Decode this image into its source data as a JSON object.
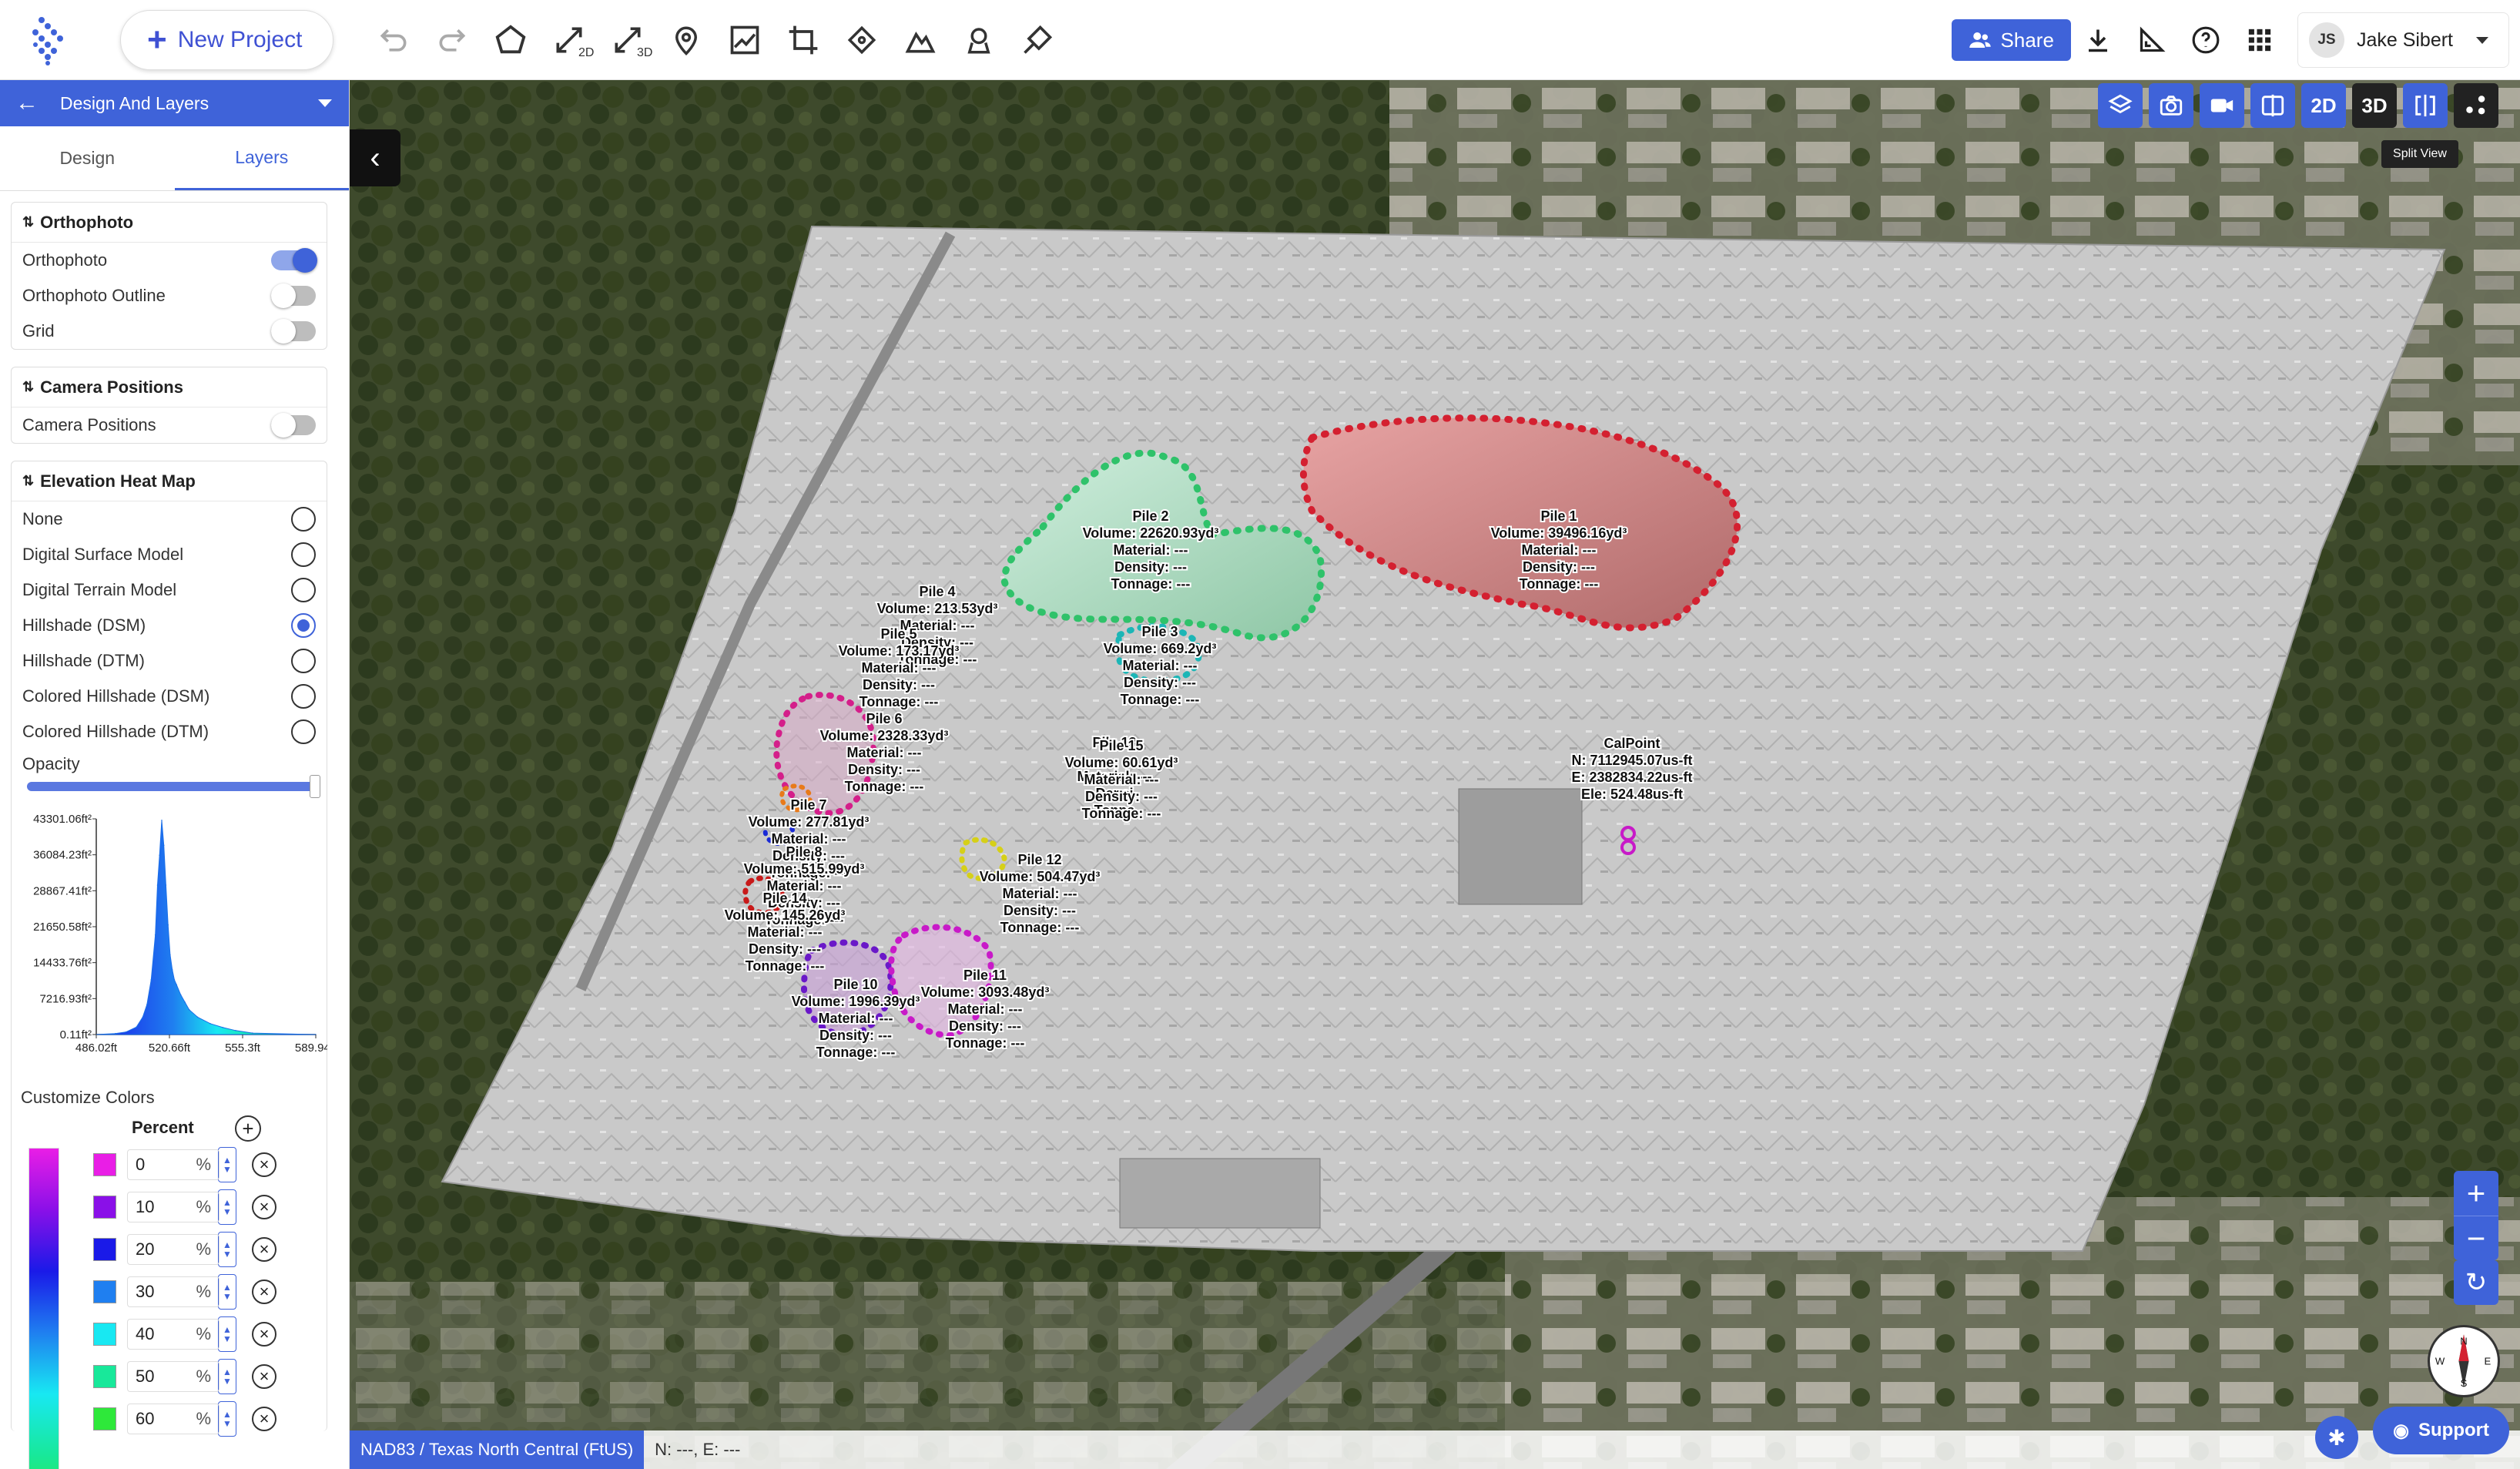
{
  "toolbar": {
    "new_project_label": "New Project",
    "tool_2d_sub": "2D",
    "tool_3d_sub": "3D",
    "share_label": "Share",
    "user_initials": "JS",
    "user_name": "Jake Sibert"
  },
  "sidebar": {
    "header_title": "Design And Layers",
    "tabs": [
      "Design",
      "Layers"
    ],
    "active_tab": "Layers",
    "orthophoto": {
      "title": "Orthophoto",
      "items": [
        {
          "label": "Orthophoto",
          "on": true
        },
        {
          "label": "Orthophoto Outline",
          "on": false
        },
        {
          "label": "Grid",
          "on": false
        }
      ]
    },
    "camera": {
      "title": "Camera Positions",
      "items": [
        {
          "label": "Camera Positions",
          "on": false
        }
      ]
    },
    "heatmap": {
      "title": "Elevation Heat Map",
      "options": [
        "None",
        "Digital Surface Model",
        "Digital Terrain Model",
        "Hillshade (DSM)",
        "Hillshade (DTM)",
        "Colored Hillshade (DSM)",
        "Colored Hillshade (DTM)"
      ],
      "selected": "Hillshade (DSM)",
      "opacity_label": "Opacity",
      "opacity_value": 1.0
    },
    "customize_colors_label": "Customize Colors",
    "percent_header": "Percent",
    "percent_suffix": "%",
    "color_stops": [
      {
        "percent": "0",
        "color": "#e91ee6"
      },
      {
        "percent": "10",
        "color": "#8a10e8"
      },
      {
        "percent": "20",
        "color": "#1a1ae8"
      },
      {
        "percent": "30",
        "color": "#1f7ff0"
      },
      {
        "percent": "40",
        "color": "#18e8f2"
      },
      {
        "percent": "50",
        "color": "#18e89a"
      },
      {
        "percent": "60",
        "color": "#2ee83a"
      }
    ]
  },
  "chart_data": {
    "type": "area",
    "title": "",
    "xlabel": "",
    "ylabel": "",
    "y_ticks": [
      "43301.06ft²",
      "36084.23ft²",
      "28867.41ft²",
      "21650.58ft²",
      "14433.76ft²",
      "7216.93ft²",
      "0.11ft²"
    ],
    "x_ticks": [
      "486.02ft",
      "520.66ft",
      "555.3ft",
      "589.94ft"
    ],
    "xlim": [
      486.02,
      589.94
    ],
    "ylim": [
      0.11,
      43301.06
    ],
    "x": [
      486.02,
      495,
      500,
      505,
      508,
      510,
      512,
      514,
      515,
      516,
      517,
      518,
      519,
      520,
      521,
      522,
      523,
      524,
      526,
      528,
      530,
      534,
      540,
      546,
      552,
      560,
      589.94
    ],
    "values": [
      0.11,
      200,
      500,
      1500,
      3500,
      6000,
      11000,
      20000,
      30000,
      36000,
      43000,
      38000,
      30000,
      22000,
      16000,
      13000,
      11000,
      10000,
      8000,
      6500,
      5000,
      3500,
      2200,
      1400,
      800,
      300,
      0.11
    ]
  },
  "map": {
    "view_2d": "2D",
    "view_3d": "3D",
    "split_view_tooltip": "Split View",
    "crs_label": "NAD83 / Texas North Central (FtUS)",
    "coords_label": "N: ---, E: ---",
    "support_label": "Support",
    "zoom_in": "+",
    "zoom_out": "−",
    "compass": {
      "n": "N",
      "s": "S",
      "e": "E",
      "w": "W"
    },
    "piles": [
      {
        "name": "Pile 1",
        "volume": "Volume: 39496.16yd³",
        "material": "Material: ---",
        "density": "Density: ---",
        "tonnage": "Tonnage: ---",
        "color": "#d42030"
      },
      {
        "name": "Pile 2",
        "volume": "Volume: 22620.93yd³",
        "material": "Material: ---",
        "density": "Density: ---",
        "tonnage": "Tonnage: ---",
        "color": "#2fc26a"
      },
      {
        "name": "Pile 3",
        "volume": "Volume: 669.2yd³",
        "material": "Material: ---",
        "density": "Density: ---",
        "tonnage": "Tonnage: ---",
        "color": "#1cb6b6"
      },
      {
        "name": "Pile 4",
        "volume": "Volume: 213.53yd³",
        "material": "Material: ---",
        "density": "Density: ---",
        "tonnage": "Tonnage: ---",
        "color": "#7ad63a"
      },
      {
        "name": "Pile 5",
        "volume": "Volume: 173.17yd³",
        "material": "Material: ---",
        "density": "Density: ---",
        "tonnage": "Tonnage: ---",
        "color": "#2a6ee8"
      },
      {
        "name": "Pile 6",
        "volume": "Volume: 2328.33yd³",
        "material": "Material: ---",
        "density": "Density: ---",
        "tonnage": "Tonnage: ---",
        "color": "#d41f8a"
      },
      {
        "name": "Pile 7",
        "volume": "Volume: 277.81yd³",
        "material": "Material: ---",
        "density": "Density: ---",
        "tonnage": "Tonnage: ---",
        "color": "#e87a1a"
      },
      {
        "name": "Pile 8",
        "volume": "Volume: 515.99yd³",
        "material": "Material: ---",
        "density": "Density: ---",
        "tonnage": "Tonnage: ---",
        "color": "#1a2ad6"
      },
      {
        "name": "Pile 10",
        "volume": "Volume: 1996.39yd³",
        "material": "Material: ---",
        "density": "Density: ---",
        "tonnage": "Tonnage: ---",
        "color": "#6a18c8"
      },
      {
        "name": "Pile 11",
        "volume": "Volume: 3093.48yd³",
        "material": "Material: ---",
        "density": "Density: ---",
        "tonnage": "Tonnage: ---",
        "color": "#c81ac8"
      },
      {
        "name": "Pile 12",
        "volume": "Volume: 504.47yd³",
        "material": "Material: ---",
        "density": "Density: ---",
        "tonnage": "Tonnage: ---",
        "color": "#d6d018"
      },
      {
        "name": "Pile 13",
        "volume": "",
        "material": "Material: ---",
        "density": "Densi",
        "tonnage": "Tonna",
        "color": "#18a8a8"
      },
      {
        "name": "Pile 14",
        "volume": "Volume: 145.26yd³",
        "material": "Material: ---",
        "density": "Density: ---",
        "tonnage": "Tonnage: ---",
        "color": "#c81a1a"
      },
      {
        "name": "Pile 15",
        "volume": "Volume: 60.61yd³",
        "material": "Material: ---",
        "density": "Density: ---",
        "tonnage": "Tonnage: ---",
        "color": "#2ac83a"
      }
    ],
    "calpoint": {
      "name": "CalPoint",
      "n": "N: 7112945.07us-ft",
      "e": "E: 2382834.22us-ft",
      "ele": "Ele: 524.48us-ft"
    }
  }
}
